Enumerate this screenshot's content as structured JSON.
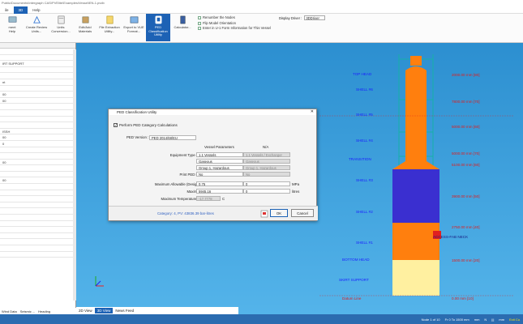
{
  "titlebar": {
    "path": "Public\\Documents\\Intergraph CAS\\PVElite\\Examples\\Vessel\\EN-1.pvdb"
  },
  "menubar": {
    "items": [
      "ile",
      "3D",
      "Help"
    ]
  },
  "ribbon": {
    "buttons": [
      {
        "label": "ment\nHelp",
        "icon": "comment-icon"
      },
      {
        "label": "Create Review\nUnits...",
        "icon": "ruler-icon"
      },
      {
        "label": "Units\nConversion...",
        "icon": "conversion-icon"
      },
      {
        "label": "Edit/Add\nMaterials",
        "icon": "materials-icon"
      },
      {
        "label": "File Extraction\nUtility...",
        "icon": "extraction-icon"
      },
      {
        "label": "Export to VUE\nFormat...",
        "icon": "export-icon"
      },
      {
        "label": "PED Classification\nUtility",
        "icon": "ped-icon"
      },
      {
        "label": "Calculator...",
        "icon": "calculator-icon"
      }
    ],
    "small_items": [
      "Renumber the Nodes",
      "Flip Model Orientation",
      "Enter in U-1 Form Information for This Vessel"
    ],
    "display_driver_label": "Display Driver :",
    "display_driver_value": "3DDriver"
  },
  "left_panel": {
    "rows": [
      "",
      "",
      "IRT SUPPORT",
      "",
      "",
      "nt",
      "",
      "00",
      "00",
      "",
      "",
      "",
      "",
      "ISSH",
      "00",
      "0",
      "",
      "",
      "00",
      "",
      "",
      "00",
      "",
      "",
      "",
      "",
      "",
      "",
      "",
      "",
      "",
      "",
      "",
      ""
    ],
    "tabs": [
      "Wind Data",
      "Seismic ...",
      "Heading"
    ]
  },
  "view_tabs": [
    "2D View",
    "3D View",
    "News Feed"
  ],
  "status": {
    "node": "Node 1 of 10",
    "from": "Fr 0 To 1500 mm",
    "units": "mm",
    "wt": "N",
    "misc": "|||",
    "ins": "mm",
    "exit": "Exit Cu"
  },
  "vessel": {
    "labels": [
      "TOP HEAD",
      "SHELL #6",
      "SHELL #5",
      "SHELL #4",
      "TRANSITION",
      "SHELL #3",
      "SHELL #2",
      "SHELL #1",
      "ACCESS-FAB NECK",
      "BOTTOM HEAD",
      "SKIRT SUPPORT",
      "Datum Line"
    ],
    "elevations": [
      "2000.00 mm [80]",
      "7800.00 mm [70]",
      "5000.00 mm [60]",
      "5000.00 mm [70]",
      "5100.00 mm [60]",
      "3900.00 mm [50]",
      "2750.00 mm [40]",
      "1500.00 mm [20]",
      "0.00 mm [10]"
    ]
  },
  "dialog": {
    "title": "PED Classification Utility",
    "close": "✕",
    "perform_label": "Perform PED Category Calculations",
    "perform_checked": "✓",
    "ped_version_label": "PED Version :",
    "ped_version_value": "PED 2014/68/EU",
    "col_vessel": "Vessel Parameters",
    "col_na": "N/A",
    "rows": [
      {
        "label": "Equipment Type per Article 4 :",
        "v1": "1.1 Vessels",
        "v2": "1.1 Vessels / Exchanger"
      },
      {
        "label": "Fluid State :",
        "v1": "Gaseous",
        "v2": "Gaseous"
      },
      {
        "label": "Fluid Group :",
        "v1": "Group 1, Hazardous",
        "v2": "Group 1, Hazardous"
      },
      {
        "label": "Print PED Module Text :",
        "v1": "No",
        "v2": "No"
      },
      {
        "label": "Maximum Allowable (Design) Pressure :",
        "v1": "0.75",
        "v2": "0",
        "unit": "MPa"
      },
      {
        "label": "Maximum Volume :",
        "v1": "5945.16",
        "v2": "0",
        "unit": "litres"
      },
      {
        "label": "Maximum Temperature (for Piping) :",
        "v1": "-17.7778",
        "unit": "C"
      }
    ],
    "category": "Category: 4, PV: 43836.39 bar-litres",
    "ok": "OK",
    "cancel": "Cancel"
  }
}
